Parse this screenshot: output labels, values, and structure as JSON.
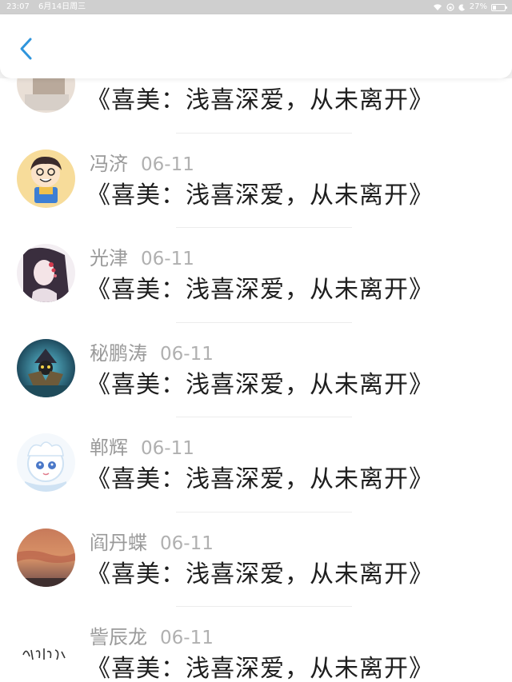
{
  "status_bar": {
    "time": "23:07",
    "date": "6月14日周三",
    "battery": "27%",
    "battery_level": 0.27,
    "icons": [
      "wifi-icon",
      "lock-rotation-icon",
      "moon-icon",
      "battery-icon"
    ]
  },
  "nav": {
    "back_icon": "chevron-left-icon",
    "accent_color": "#2f95dc"
  },
  "items": [
    {
      "name": "",
      "date": "",
      "title": "《喜美：浅喜深爱，从未离开》",
      "avatar": "avatar-partial"
    },
    {
      "name": "冯济",
      "date": "06-11",
      "title": "《喜美：浅喜深爱，从未离开》",
      "avatar": "cartoon-boy-avatar"
    },
    {
      "name": "光津",
      "date": "06-11",
      "title": "《喜美：浅喜深爱，从未离开》",
      "avatar": "anime-girl-avatar"
    },
    {
      "name": "秘鹏涛",
      "date": "06-11",
      "title": "《喜美：浅喜深爱，从未离开》",
      "avatar": "game-character-avatar"
    },
    {
      "name": "郸辉",
      "date": "06-11",
      "title": "《喜美：浅喜深爱，从未离开》",
      "avatar": "chibi-character-avatar"
    },
    {
      "name": "阎丹蝶",
      "date": "06-11",
      "title": "《喜美：浅喜深爱，从未离开》",
      "avatar": "sunset-sky-avatar"
    },
    {
      "name": "訾辰龙",
      "date": "06-11",
      "title": "《喜美：浅喜深爱，从未离开》",
      "avatar": "calligraphy-avatar"
    }
  ]
}
